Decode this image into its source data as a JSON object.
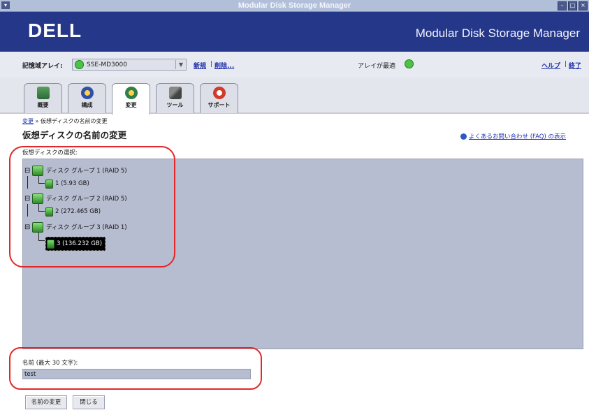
{
  "window": {
    "title": "Modular Disk Storage Manager",
    "sysmenu_icon": "window-menu-icon",
    "buttons": [
      "minimize-icon",
      "maximize-icon",
      "close-icon"
    ]
  },
  "banner": {
    "logo": "DELL",
    "product": "Modular Disk Storage Manager",
    "bg_color": "#253789"
  },
  "array_bar": {
    "label": "記憶域アレイ:",
    "selected_array": "SSE-MD3000",
    "new_link": "新規",
    "separator": "|",
    "delete_link": "削除...",
    "status_text": "アレイが最適",
    "help_link": "ヘルプ",
    "exit_link": "終了"
  },
  "tabs": [
    {
      "label": "概要",
      "icon": "summary-icon",
      "active": false
    },
    {
      "label": "構成",
      "icon": "configure-icon",
      "active": false
    },
    {
      "label": "変更",
      "icon": "modify-icon",
      "active": true
    },
    {
      "label": "ツール",
      "icon": "tools-icon",
      "active": false
    },
    {
      "label": "サポート",
      "icon": "support-icon",
      "active": false
    }
  ],
  "breadcrumb": {
    "parent": "変更",
    "separator": "»",
    "current": "仮想ディスクの名前の変更"
  },
  "page_title": "仮想ディスクの名前の変更",
  "faq_link": "よくあるお問い合わせ (FAQ) の表示",
  "tree": {
    "label": "仮想ディスクの選択:",
    "groups": [
      {
        "label": "ディスク グループ 1 (RAID 5)",
        "volume": "1 (5.93 GB)"
      },
      {
        "label": "ディスク グループ 2 (RAID 5)",
        "volume": "2 (272.465 GB)"
      },
      {
        "label": "ディスク グループ 3 (RAID 1)",
        "volume": "3 (136.232 GB)",
        "selected": true
      }
    ]
  },
  "name_field": {
    "label": "名前 (最大 30 文字):",
    "value": "test"
  },
  "buttons": {
    "rename": "名前の変更",
    "close": "閉じる"
  },
  "colors": {
    "annotation": "#e4272a",
    "link": "#1d2fa8",
    "panel": "#b7bdd0",
    "status_ok": "#4bc444"
  }
}
